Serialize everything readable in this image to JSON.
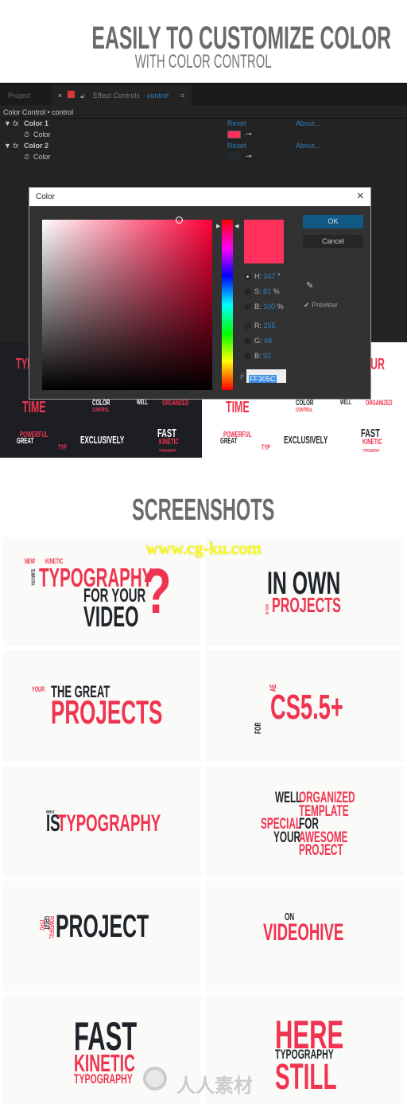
{
  "header": {
    "title": "EASILY TO CUSTOMIZE COLOR",
    "subtitle": "WITH COLOR CONTROL"
  },
  "panel": {
    "tabs": {
      "project": "Project",
      "close": "×",
      "effect_controls": "Effect Controls",
      "layer": "control",
      "menu": "≡"
    },
    "breadcrumb": "Color Control • control",
    "effects": [
      {
        "name": "Color 1",
        "prop": "Color",
        "reset": "Reset",
        "about": "About...",
        "swatch": "#FF305C"
      },
      {
        "name": "Color 2",
        "prop": "Color",
        "reset": "Reset",
        "about": "About...",
        "swatch": "#252830"
      }
    ]
  },
  "dialog": {
    "title": "Color",
    "close": "×",
    "ok": "OK",
    "cancel": "Cancel",
    "preview": "Preview",
    "preview_checked": true,
    "fields": [
      {
        "label": "H:",
        "value": "347",
        "unit": "°",
        "selected": true
      },
      {
        "label": "S:",
        "value": "81",
        "unit": "%"
      },
      {
        "label": "B:",
        "value": "100",
        "unit": "%"
      },
      {
        "label": "R:",
        "value": "255",
        "unit": ""
      },
      {
        "label": "G:",
        "value": "48",
        "unit": ""
      },
      {
        "label": "B:",
        "value": "92",
        "unit": ""
      }
    ],
    "hex_label": "#",
    "hex": "FF305C",
    "color": "#FF305C"
  },
  "previews": {
    "dark": [
      "TYP",
      "TIME",
      "COLOR",
      "CONTROL",
      "WELL",
      "ORGANIZED",
      "POWERFUL",
      "GREAT",
      "TYP",
      "EXCLUSIVELY",
      "FAST",
      "KINETIC",
      "TYPOGRAPHY"
    ],
    "light": [
      "UR",
      "TIME",
      "COLOR",
      "CONTROL",
      "WELL",
      "ORGANIZED",
      "POWERFUL",
      "GREAT",
      "TYP",
      "EXCLUSIVELY",
      "FAST",
      "KINETIC",
      "TYPOGRAPHY"
    ]
  },
  "screenshots_title": "SCREENSHOTS",
  "watermark": "www.cg-ku.com",
  "watermark2": "人人素材",
  "tiles": [
    {
      "a": "NEW",
      "b": "KINETIC",
      "c": "YOU WRITE",
      "d": "TYPOGRAPHY",
      "e": "FOR YOUR",
      "f": "VIDEO",
      "g": "?"
    },
    {
      "a": "IN OWN",
      "b": "PROJECTS",
      "c": "IN YOUR"
    },
    {
      "a": "YOUR",
      "b": "THE GREAT",
      "c": "PROJECTS"
    },
    {
      "a": "FOR",
      "b": "AE",
      "c": "CS5.5+"
    },
    {
      "a": "WHAT",
      "b": "IS",
      "c": "TYPOGRAPHY"
    },
    {
      "a": "WELL",
      "b": "ORGANIZED",
      "c": "TEMPLATE",
      "d": "SPECIAL",
      "e": "FOR",
      "f": "YOUR",
      "g": "AWESOME",
      "h": "PROJECT"
    },
    {
      "a": "POWERFUL",
      "b": "GREAT",
      "c": "TYPO",
      "d": "PROJECT"
    },
    {
      "a": "ON",
      "b": "VIDEOHIVE"
    },
    {
      "a": "FAST",
      "b": "KINETIC",
      "c": "TYPOGRAPHY"
    },
    {
      "a": "HERE",
      "b": "TYPOGRAPHY",
      "c": "STILL"
    }
  ]
}
